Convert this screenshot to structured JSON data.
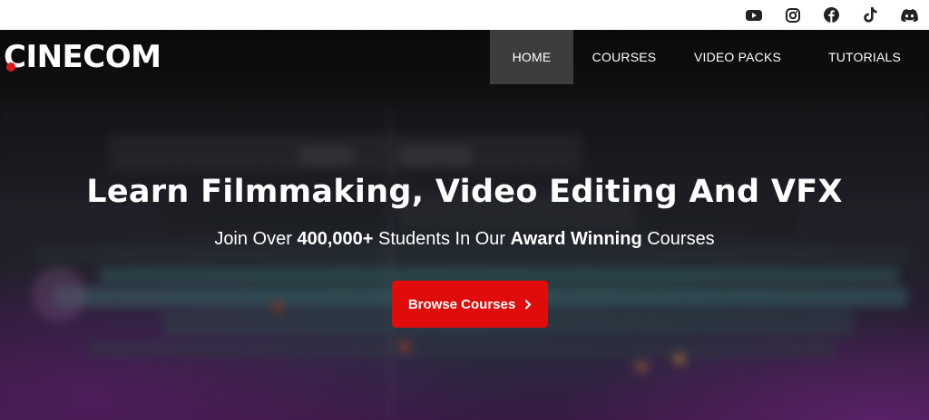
{
  "brand": {
    "name": "Cinecom",
    "logo_text": "CINECOM",
    "accent": "#e00b0b"
  },
  "social": [
    {
      "icon": "youtube-icon",
      "label": "YouTube"
    },
    {
      "icon": "instagram-icon",
      "label": "Instagram"
    },
    {
      "icon": "facebook-icon",
      "label": "Facebook"
    },
    {
      "icon": "tiktok-icon",
      "label": "TikTok"
    },
    {
      "icon": "discord-icon",
      "label": "Discord"
    }
  ],
  "nav": {
    "items": [
      {
        "label": "HOME",
        "active": true
      },
      {
        "label": "COURSES",
        "active": false
      },
      {
        "label": "VIDEO PACKS",
        "active": false
      },
      {
        "label": "TUTORIALS",
        "active": false
      }
    ]
  },
  "hero": {
    "headline": "Learn Filmmaking, Video Editing And VFX",
    "sub_prefix": "Join Over ",
    "sub_count": "400,000+",
    "sub_middle": " Students In Our ",
    "sub_highlight": "Award Winning",
    "sub_suffix": " Courses",
    "cta_label": "Browse Courses",
    "cta_icon": "chevron-right-icon"
  }
}
